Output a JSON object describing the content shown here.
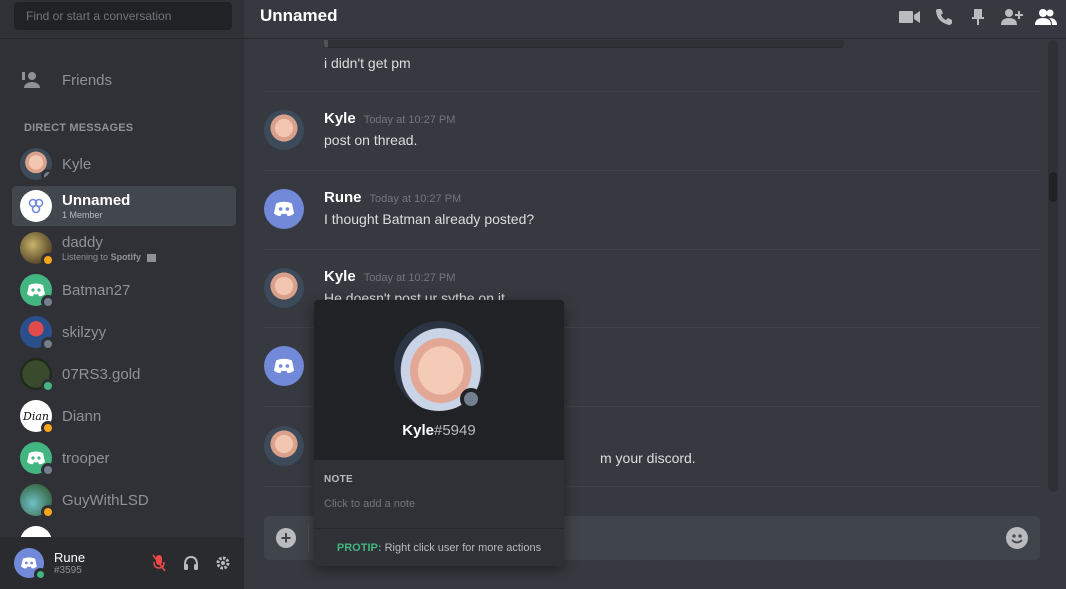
{
  "search": {
    "placeholder": "Find or start a conversation"
  },
  "friends": {
    "label": "Friends"
  },
  "dm_section": {
    "header": "DIRECT MESSAGES"
  },
  "dms": [
    {
      "name": "Kyle",
      "status": "offline"
    },
    {
      "name": "Unnamed",
      "sub": "1 Member",
      "active": true
    },
    {
      "name": "daddy",
      "status": "idle",
      "sub_prefix": "Listening to",
      "sub_bold": "Spotify"
    },
    {
      "name": "Batman27",
      "status": "offline"
    },
    {
      "name": "skilzyy",
      "status": "offline"
    },
    {
      "name": "07RS3.gold",
      "status": "online"
    },
    {
      "name": "Diann",
      "status": "idle",
      "avatar_text": "Dian"
    },
    {
      "name": "trooper",
      "status": "offline"
    },
    {
      "name": "GuyWithLSD",
      "status": "idle"
    }
  ],
  "user_panel": {
    "name": "Rune",
    "tag": "#3595",
    "status": "online"
  },
  "header": {
    "title": "Unnamed"
  },
  "messages": {
    "prev_line": "i didn't get pm",
    "items": [
      {
        "author": "Kyle",
        "time": "Today at 10:27 PM",
        "text": "post on thread."
      },
      {
        "author": "Rune",
        "time": "Today at 10:27 PM",
        "text": "I thought Batman already posted?"
      },
      {
        "author": "Kyle",
        "time": "Today at 10:27 PM",
        "text": "He doesn't post ur sythe on it"
      },
      {
        "author": "",
        "time": "",
        "text": ""
      },
      {
        "author": "",
        "time": "",
        "text": "m your discord."
      }
    ]
  },
  "popout": {
    "username": "Kyle",
    "discriminator": "#5949",
    "note_header": "NOTE",
    "note_placeholder": "Click to add a note",
    "protip_label": "PROTIP:",
    "protip_text": "Right click user for more actions"
  },
  "colors": {
    "blurple": "#7289da",
    "online": "#43b581",
    "idle": "#faa61a",
    "offline": "#747f8d"
  }
}
